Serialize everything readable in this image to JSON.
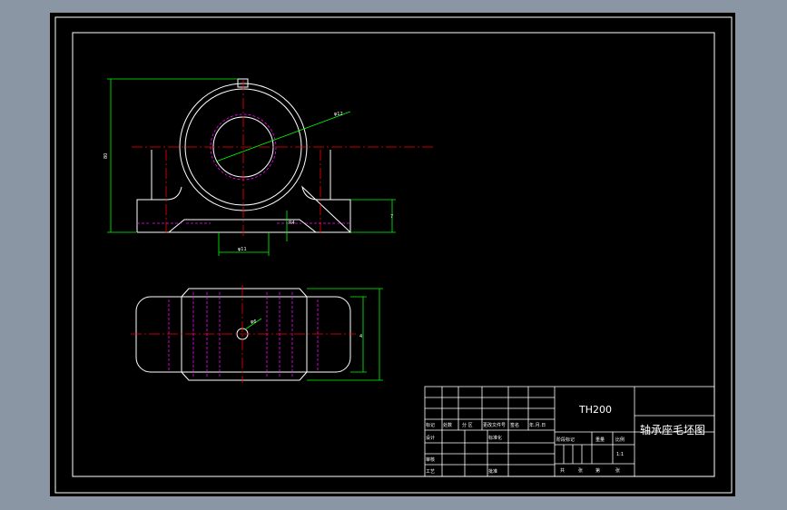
{
  "colors": {
    "background": "#8b96a4",
    "sheet": "#000000",
    "outline": "#ffffff",
    "centerline": "#ff0000",
    "hidden_line": "#ff00ff",
    "dimension": "#00ff00",
    "text": "#ffffff"
  },
  "title_block": {
    "part_number": "TH200",
    "part_name": "轴承座毛坯图",
    "scale": "1:1",
    "revision_headers": [
      "标记",
      "处数",
      "分 区",
      "更改文件号",
      "签名",
      "年.月.日"
    ],
    "design_label": "设计",
    "standardization_label": "标准化",
    "approval_label": "批准",
    "review_label": "审核",
    "process_label": "工艺",
    "stage_headers": [
      "阶段标记",
      "重量",
      "比例"
    ],
    "sheet_labels": [
      "共",
      "张",
      "第",
      "张"
    ]
  },
  "dimensions": {
    "height": "80",
    "hole": "φ12",
    "left_bottom": "φ11",
    "radius": "R4",
    "right_side": "7",
    "top_plan": "φ6",
    "width_plan": "4"
  }
}
